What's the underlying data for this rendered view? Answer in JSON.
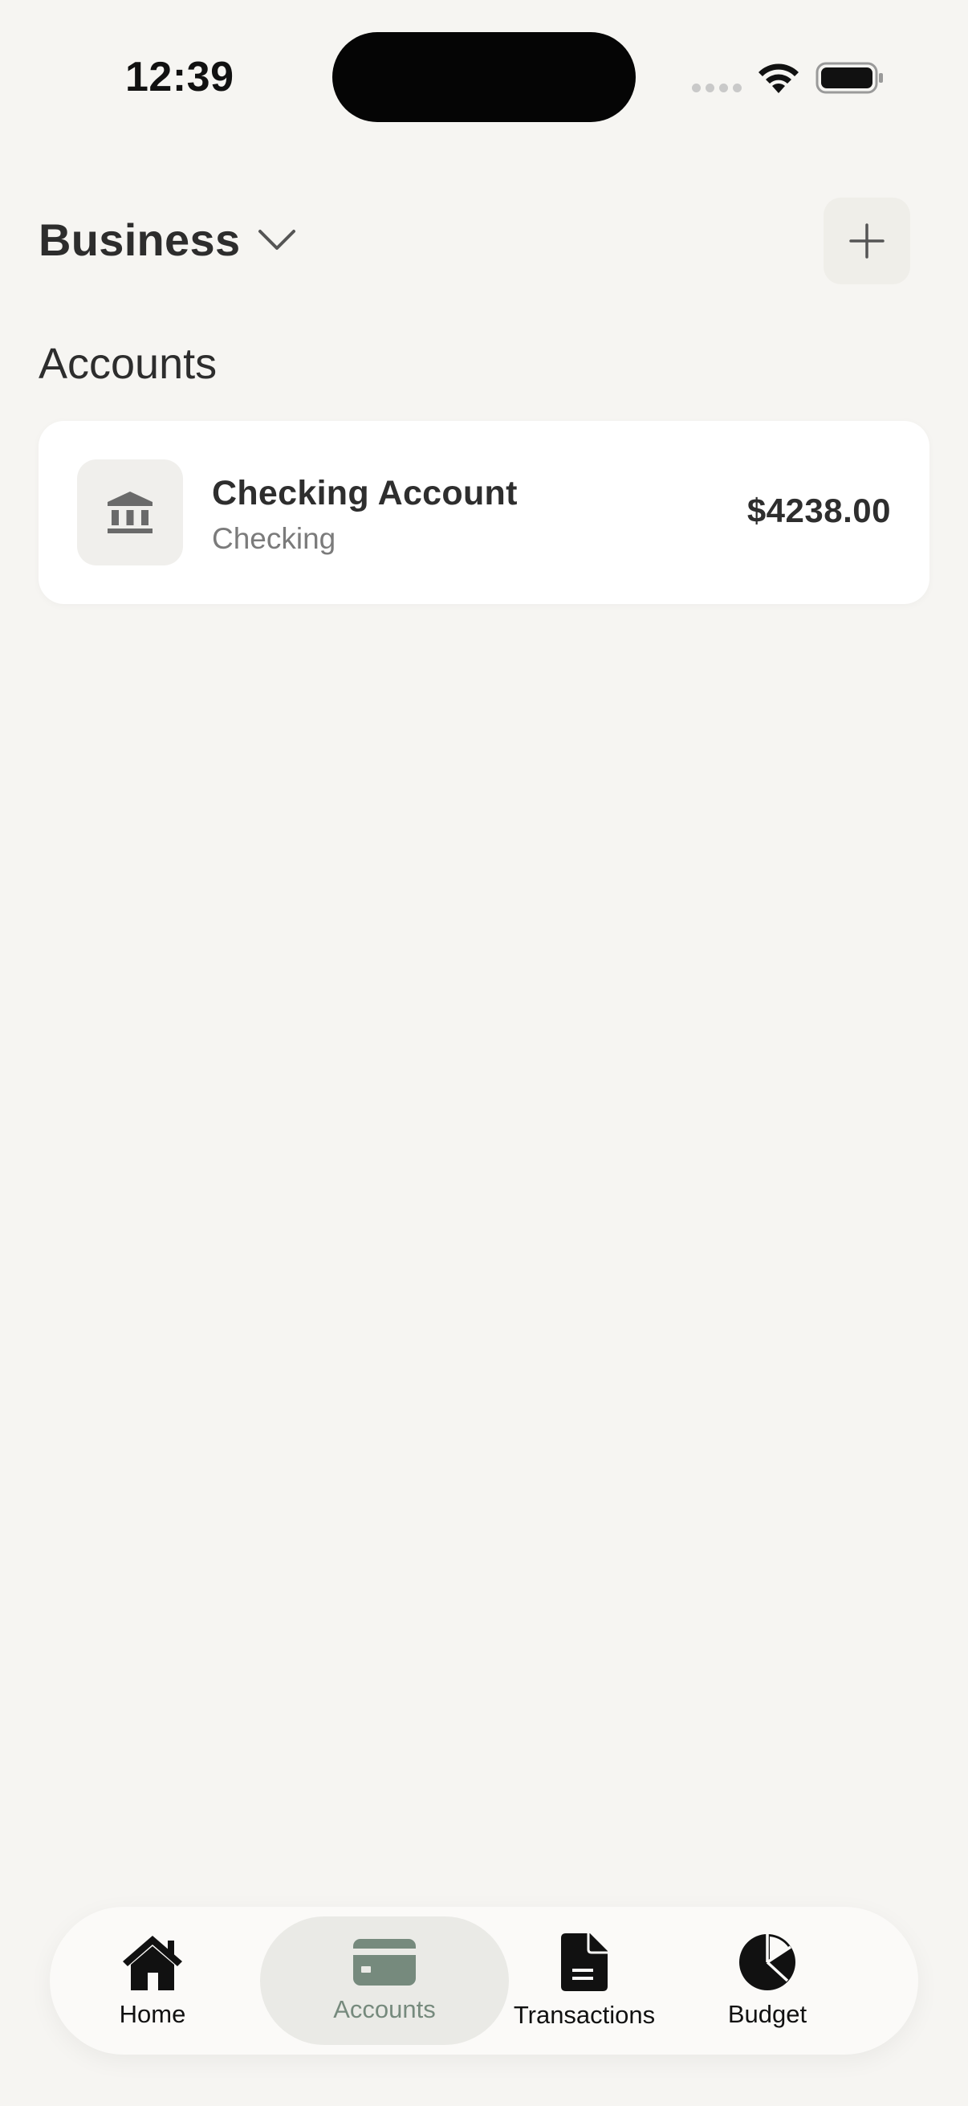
{
  "status_bar": {
    "time": "12:39",
    "icons": [
      "cellular-signal-icon",
      "wifi-icon",
      "battery-icon"
    ]
  },
  "header": {
    "workspace_label": "Business",
    "workspace_icon": "chevron-down-icon",
    "add_icon": "plus-icon"
  },
  "section": {
    "title": "Accounts"
  },
  "accounts": [
    {
      "name": "Checking Account",
      "type": "Checking",
      "balance": "$4238.00",
      "icon": "bank-icon"
    }
  ],
  "tab_bar": {
    "active": "Accounts",
    "accent_color": "#768a7d",
    "tabs": [
      {
        "label": "Home",
        "icon": "home-icon"
      },
      {
        "label": "Accounts",
        "icon": "credit-card-icon"
      },
      {
        "label": "Transactions",
        "icon": "document-icon"
      },
      {
        "label": "Budget",
        "icon": "pie-chart-icon"
      }
    ]
  }
}
